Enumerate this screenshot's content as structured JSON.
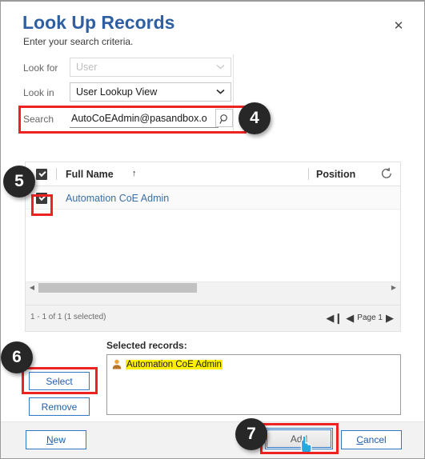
{
  "dialog": {
    "title": "Look Up Records",
    "subtitle": "Enter your search criteria.",
    "close_label": "✕"
  },
  "criteria": {
    "look_for": {
      "label": "Look for",
      "value": "User",
      "disabled": true
    },
    "look_in": {
      "label": "Look in",
      "value": "User Lookup View",
      "disabled": false
    },
    "search": {
      "label": "Search",
      "value": "AutoCoEAdmin@pasandbox.o",
      "placeholder": "Search",
      "go_icon": "search-icon"
    }
  },
  "grid": {
    "header_select_all_checked": true,
    "columns": [
      {
        "label": "Full Name",
        "sort": "↑"
      },
      {
        "label": "Position",
        "sort": ""
      }
    ],
    "refresh_icon": "refresh-icon",
    "rows": [
      {
        "checked": true,
        "full_name": "Automation CoE Admin",
        "position": ""
      }
    ],
    "scroll": {
      "left_arrow": "◀",
      "right_arrow": "▶"
    }
  },
  "pager": {
    "count_text": "1 - 1 of 1 (1 selected)",
    "first_icon": "◀❙",
    "prev_icon": "◀",
    "page_label": "Page 1",
    "next_icon": "▶"
  },
  "selected_records": {
    "label": "Selected records:",
    "items": [
      {
        "icon": "user-icon",
        "name": "Automation CoE Admin",
        "highlighted": true
      }
    ]
  },
  "buttons": {
    "select": "Select",
    "remove": "Remove",
    "new": "New",
    "new_accel": "N",
    "add": "Add",
    "cancel": "Cancel",
    "cancel_accel": "C"
  },
  "annotations": {
    "badges": [
      {
        "number": "4",
        "target": "search-row"
      },
      {
        "number": "5",
        "target": "grid-row-checkbox"
      },
      {
        "number": "6",
        "target": "select-button"
      },
      {
        "number": "7",
        "target": "add-button"
      }
    ],
    "highlight_color": "#ee2222",
    "badge_color": "#272727"
  },
  "theme": {
    "title_blue": "#2e5fa3",
    "link_blue": "#3a6ea5",
    "button_border_blue": "#2e78c4",
    "highlight_yellow": "#fff000"
  }
}
